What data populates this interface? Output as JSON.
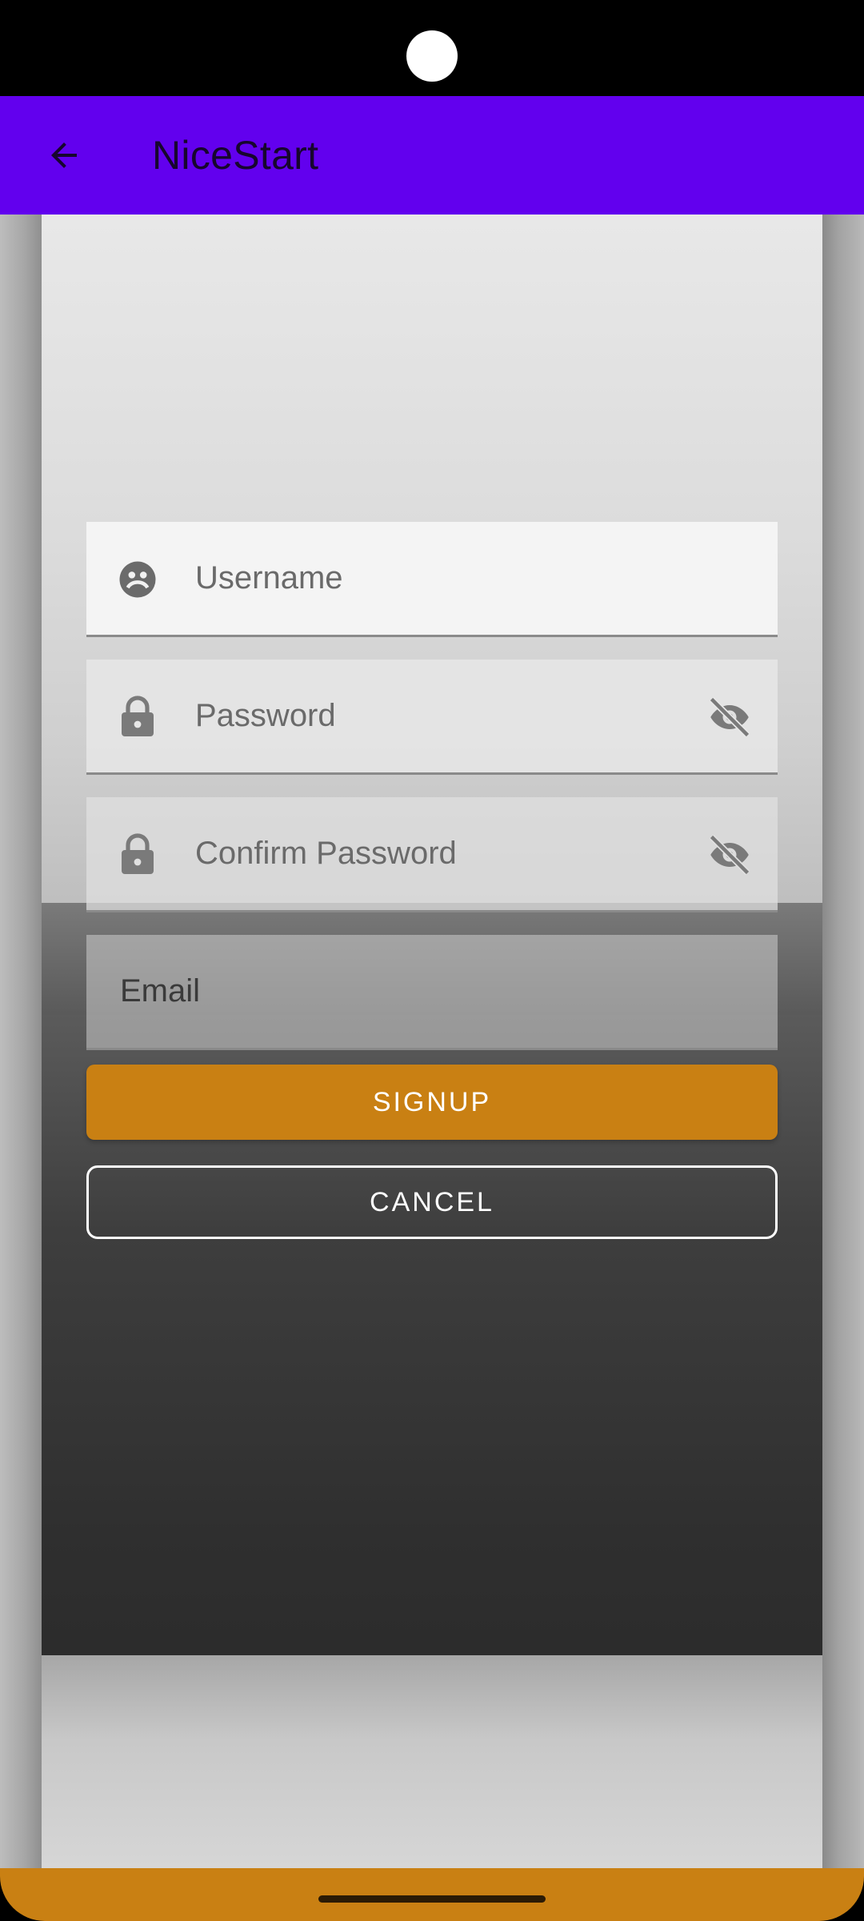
{
  "app_bar": {
    "title": "NiceStart",
    "back_icon": "arrow-left-icon",
    "color": "#6200EE"
  },
  "form": {
    "username": {
      "placeholder": "Username",
      "value": "",
      "icon": "account-circle-icon"
    },
    "password": {
      "placeholder": "Password",
      "value": "",
      "icon": "lock-icon",
      "toggle_icon": "eye-off-icon"
    },
    "confirm_password": {
      "placeholder": "Confirm Password",
      "value": "",
      "icon": "lock-icon",
      "toggle_icon": "eye-off-icon"
    },
    "email": {
      "placeholder": "Email",
      "value": ""
    }
  },
  "buttons": {
    "signup_label": "SIGNUP",
    "cancel_label": "CANCEL"
  },
  "colors": {
    "accent": "#C98013",
    "app_bar": "#6200EE"
  }
}
